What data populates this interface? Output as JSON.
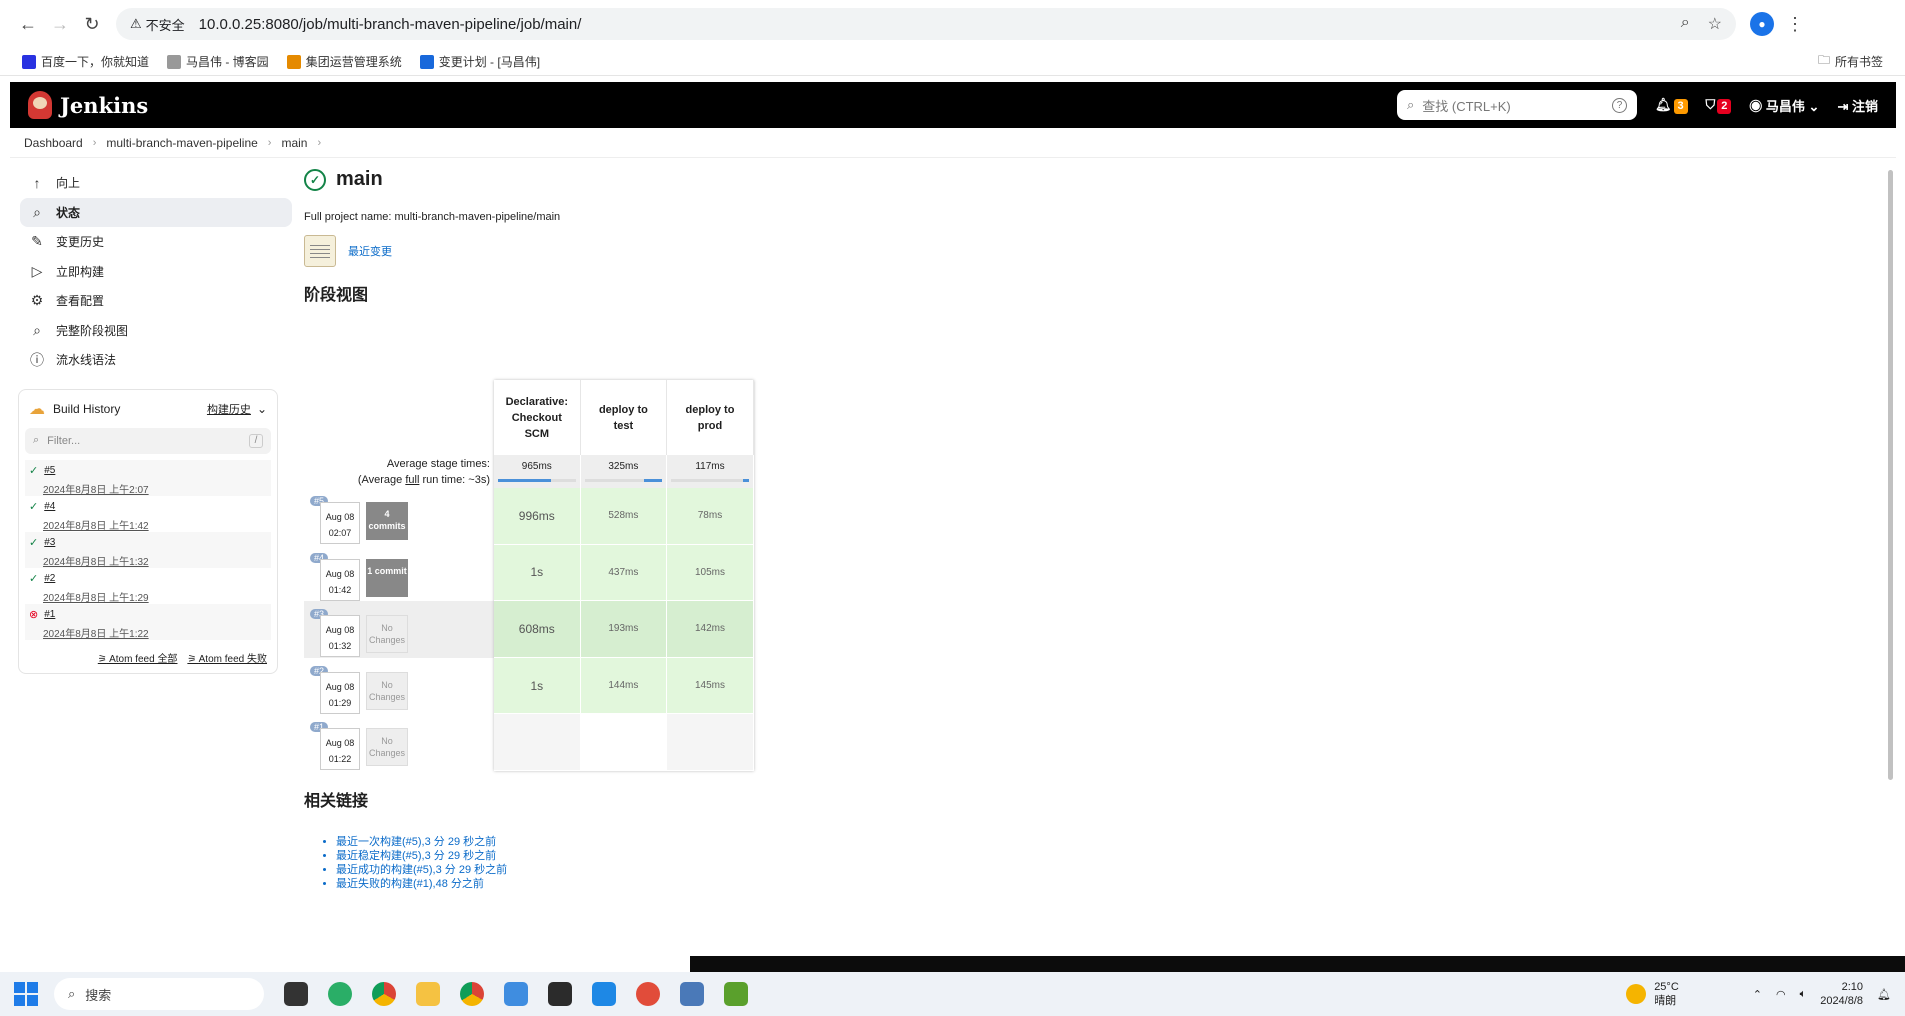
{
  "browser": {
    "insecure_label": "不安全",
    "url": "10.0.0.25:8080/job/multi-branch-maven-pipeline/job/main/",
    "bookmarks": [
      "百度一下，你就知道",
      "马昌伟 - 博客园",
      "集团运营管理系统",
      "变更计划 - [马昌伟]"
    ],
    "all_bookmarks": "所有书签"
  },
  "header": {
    "brand": "Jenkins",
    "search_placeholder": "查找 (CTRL+K)",
    "notifications_count": "3",
    "security_count": "2",
    "user": "马昌伟",
    "logout": "注销"
  },
  "breadcrumb": [
    "Dashboard",
    "multi-branch-maven-pipeline",
    "main"
  ],
  "sidebar": {
    "tasks": [
      "向上",
      "状态",
      "变更历史",
      "立即构建",
      "查看配置",
      "完整阶段视图",
      "流水线语法"
    ],
    "build_history": {
      "title": "Build History",
      "trend": "构建历史",
      "filter_placeholder": "Filter...",
      "filter_shortcut": "/",
      "builds": [
        {
          "num": "#5",
          "time": "2024年8月8日 上午2:07",
          "status": "ok"
        },
        {
          "num": "#4",
          "time": "2024年8月8日 上午1:42",
          "status": "ok"
        },
        {
          "num": "#3",
          "time": "2024年8月8日 上午1:32",
          "status": "ok"
        },
        {
          "num": "#2",
          "time": "2024年8月8日 上午1:29",
          "status": "ok"
        },
        {
          "num": "#1",
          "time": "2024年8月8日 上午1:22",
          "status": "fail"
        }
      ],
      "feed_all": "Atom feed 全部",
      "feed_fail": "Atom feed 失败"
    }
  },
  "main": {
    "title": "main",
    "full_name": "Full project name: multi-branch-maven-pipeline/main",
    "recent_changes": "最近变更",
    "stage_view_title": "阶段视图",
    "avg_label_1": "Average stage times:",
    "avg_label_2a": "(Average ",
    "avg_label_2b": "full",
    "avg_label_2c": " run time: ~3s)",
    "stages": [
      {
        "name": "Declarative: Checkout SCM",
        "avg": "965ms",
        "bar": 0.68
      },
      {
        "name": "deploy to test",
        "avg": "325ms",
        "bar": 0.23
      },
      {
        "name": "deploy to prod",
        "avg": "117ms",
        "bar": 0.08
      }
    ],
    "runs": [
      {
        "num": "#5",
        "date": "Aug 08",
        "time": "02:07",
        "changes": "4 commits",
        "has": true,
        "cells": [
          "996ms",
          "528ms",
          "78ms"
        ]
      },
      {
        "num": "#4",
        "date": "Aug 08",
        "time": "01:42",
        "changes": "1 commit",
        "has": true,
        "cells": [
          "1s",
          "437ms",
          "105ms"
        ]
      },
      {
        "num": "#3",
        "date": "Aug 08",
        "time": "01:32",
        "changes": "No Changes",
        "has": false,
        "cells": [
          "608ms",
          "193ms",
          "142ms"
        ]
      },
      {
        "num": "#2",
        "date": "Aug 08",
        "time": "01:29",
        "changes": "No Changes",
        "has": false,
        "cells": [
          "1s",
          "144ms",
          "145ms"
        ]
      },
      {
        "num": "#1",
        "date": "Aug 08",
        "time": "01:22",
        "changes": "No Changes",
        "has": false,
        "cells": [
          "",
          "",
          ""
        ]
      }
    ],
    "related_title": "相关链接",
    "related_links": [
      "最近一次构建(#5),3 分 29 秒之前",
      "最近稳定构建(#5),3 分 29 秒之前",
      "最近成功的构建(#5),3 分 29 秒之前",
      "最近失败的构建(#1),48 分之前"
    ]
  },
  "taskbar": {
    "search": "搜索",
    "temp": "25°C",
    "weather": "晴朗",
    "time": "2:10",
    "date": "2024/8/8"
  }
}
